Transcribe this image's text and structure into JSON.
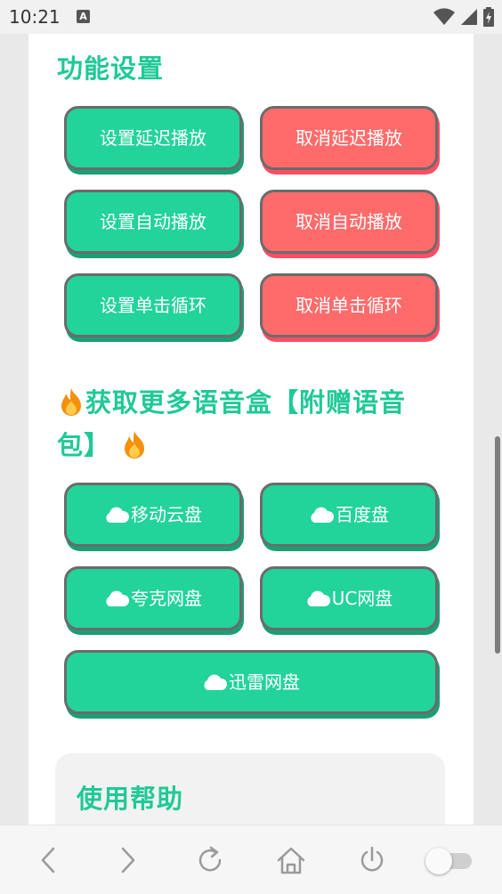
{
  "status_bar": {
    "time": "10:21",
    "notification_badge": "A"
  },
  "function_settings": {
    "title": "功能设置",
    "buttons": [
      {
        "label": "设置延迟播放"
      },
      {
        "label": "取消延迟播放"
      },
      {
        "label": "设置自动播放"
      },
      {
        "label": "取消自动播放"
      },
      {
        "label": "设置单击循环"
      },
      {
        "label": "取消单击循环"
      }
    ]
  },
  "more_voice": {
    "title_line1": "获取更多语音盒【附赠语音",
    "title_line2": "包】",
    "buttons": [
      {
        "label": "移动云盘"
      },
      {
        "label": "百度盘"
      },
      {
        "label": "夸克网盘"
      },
      {
        "label": "UC网盘"
      },
      {
        "label": "迅雷网盘"
      }
    ]
  },
  "help": {
    "title": "使用帮助"
  },
  "colors": {
    "accent": "#20c997",
    "green_button": "#22d39a",
    "red_button": "#ff6b6b"
  },
  "icons": [
    "wifi-icon",
    "signal-icon",
    "battery-icon",
    "cloud-icon",
    "fire-icon",
    "back-icon",
    "forward-icon",
    "refresh-icon",
    "home-icon",
    "power-icon"
  ]
}
